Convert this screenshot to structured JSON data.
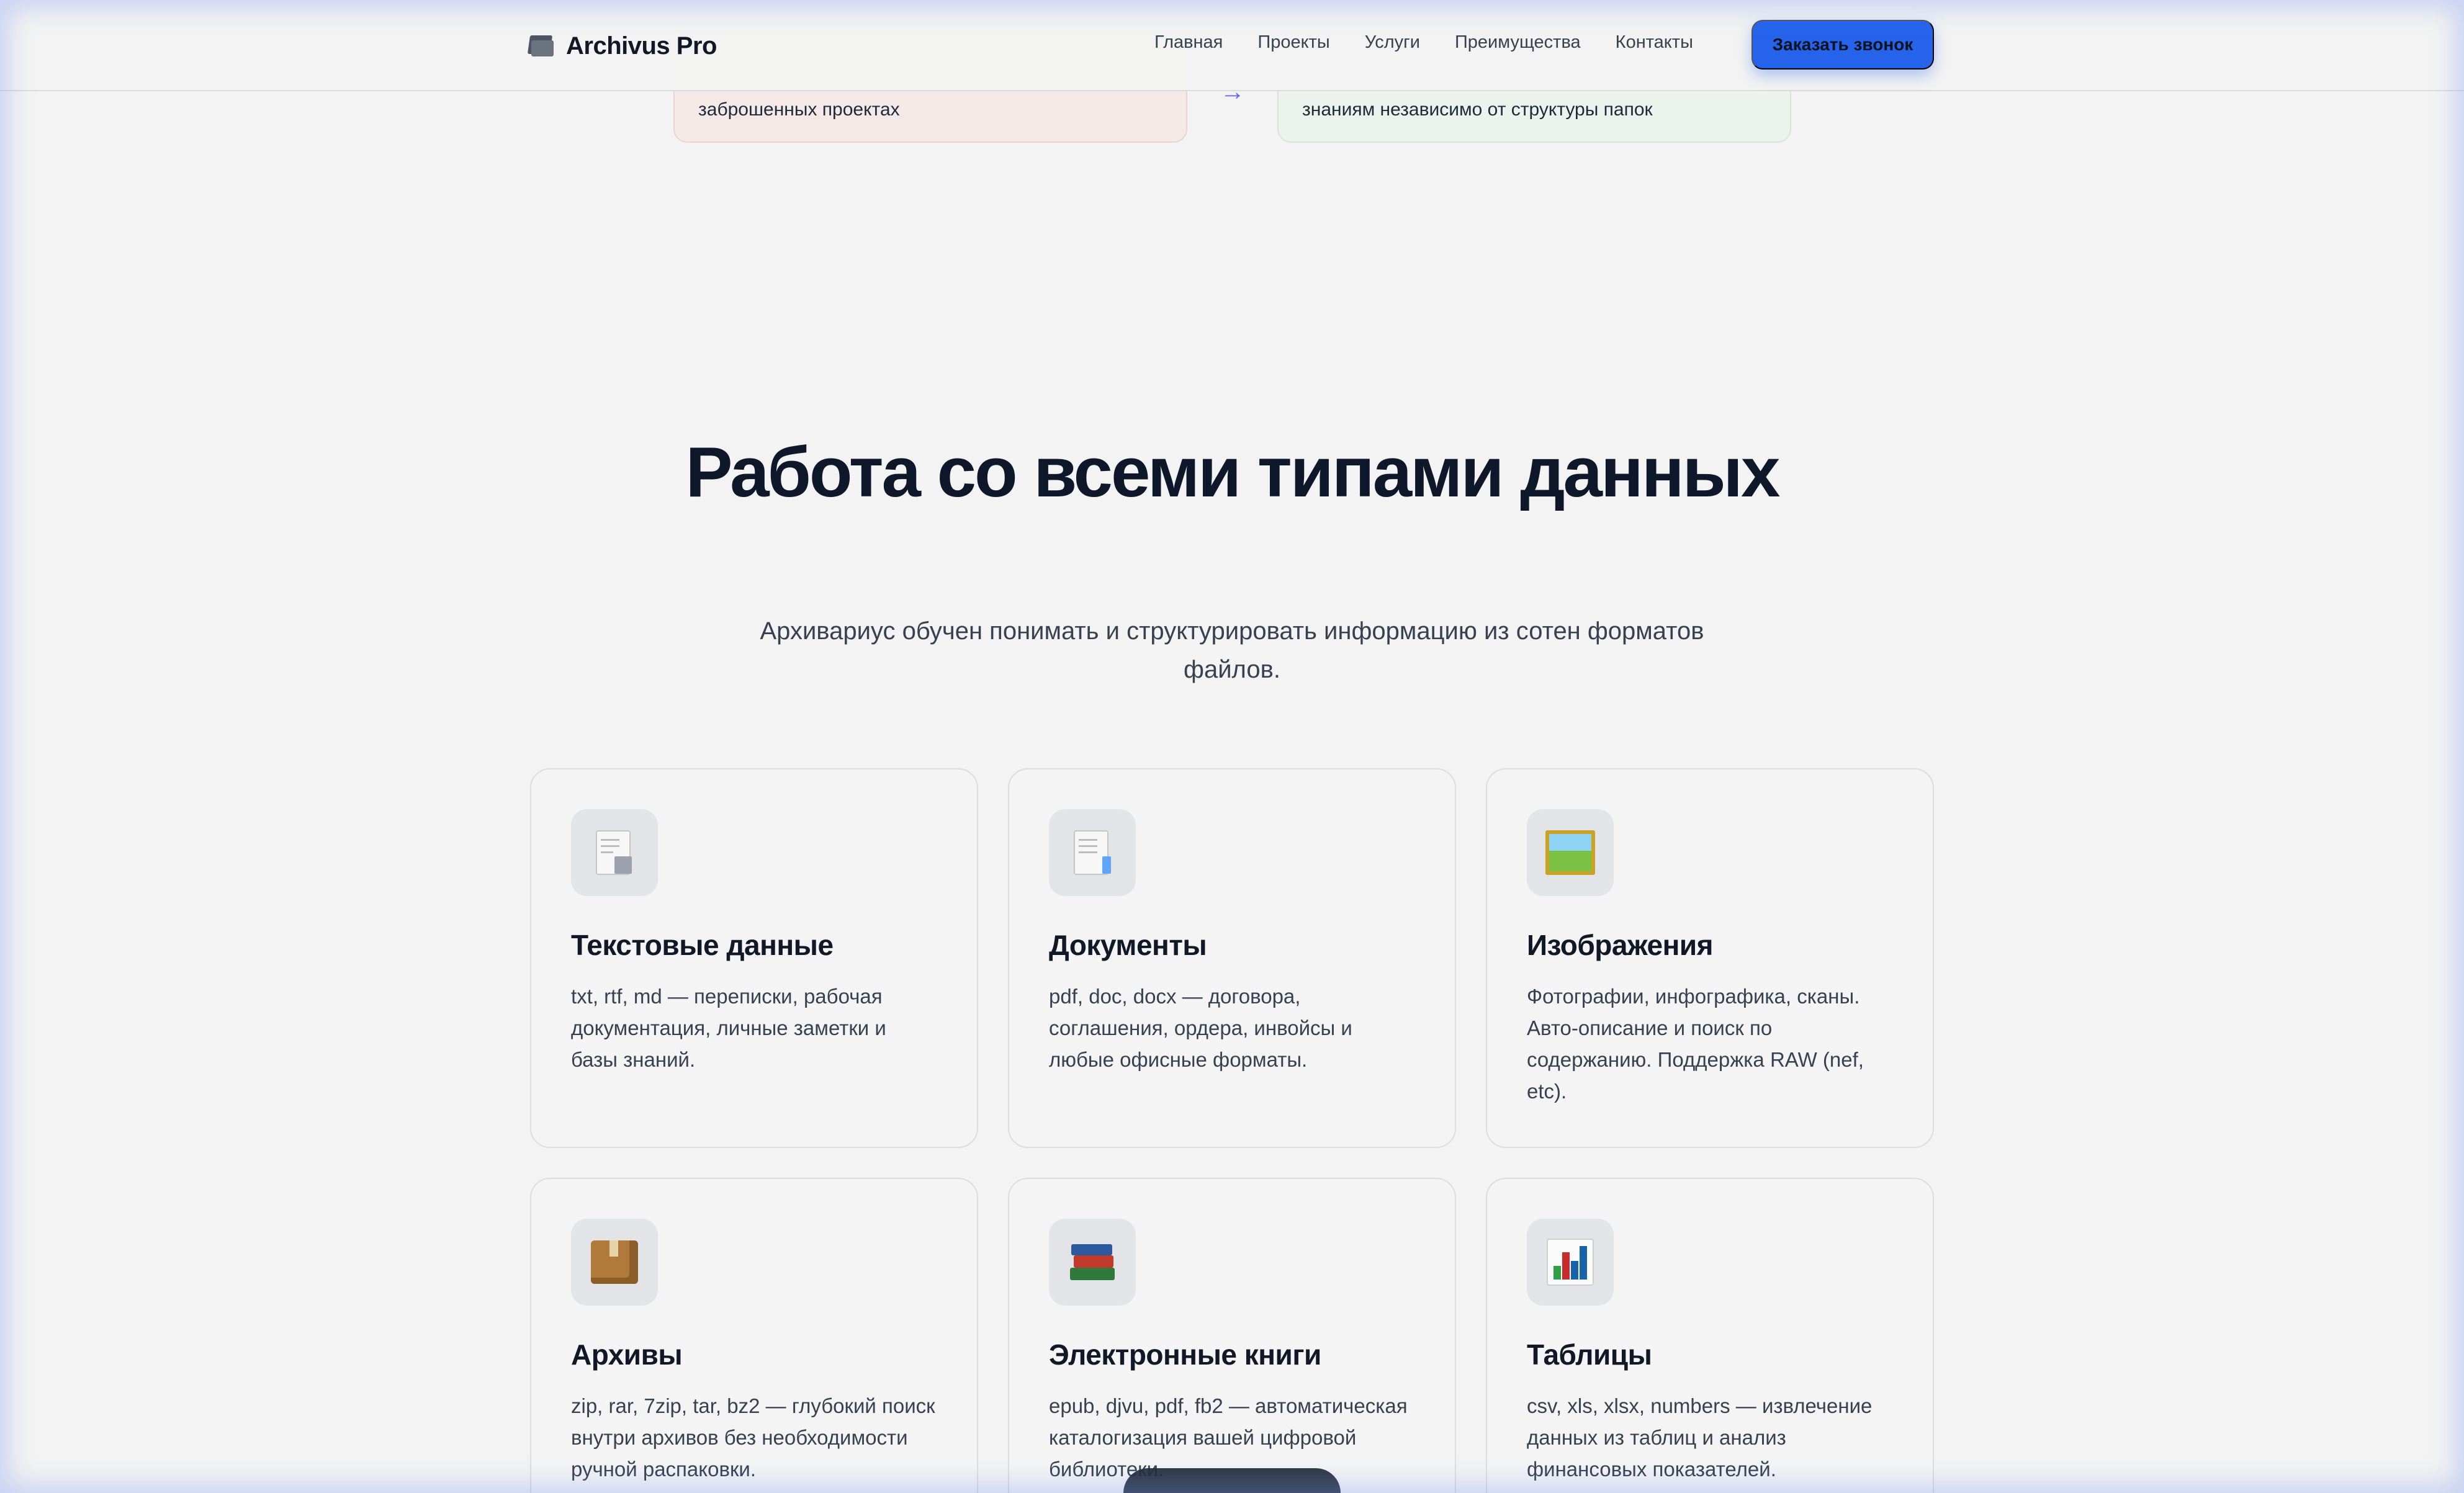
{
  "header": {
    "logo_text": "Archivus Pro",
    "logo_icon": "folder-icon",
    "nav": [
      "Главная",
      "Проекты",
      "Услуги",
      "Преимущества",
      "Контакты"
    ],
    "cta_label": "Заказать звонок",
    "accent_color": "#2563eb"
  },
  "compare": {
    "bad_text": "заброшенных проектах",
    "good_text": "знаниям независимо от структуры папок",
    "arrow": "→"
  },
  "section": {
    "title": "Работа со всеми типами данных",
    "subtitle": "Архивариус обучен понимать и структурировать информацию из сотен форматов файлов."
  },
  "cards": [
    {
      "icon": "text-file-icon",
      "title": "Текстовые данные",
      "desc": "txt, rtf, md — переписки, рабочая документация, личные заметки и базы знаний."
    },
    {
      "icon": "document-icon",
      "title": "Документы",
      "desc": "pdf, doc, docx — договора, соглашения, ордера, инвойсы и любые офисные форматы."
    },
    {
      "icon": "picture-icon",
      "title": "Изображения",
      "desc": "Фотографии, инфографика, сканы. Авто-описание и поиск по содержанию. Поддержка RAW (nef, etc)."
    },
    {
      "icon": "package-icon",
      "title": "Архивы",
      "desc": "zip, rar, 7zip, tar, bz2 — глубокий поиск внутри архивов без необходимости ручной распаковки."
    },
    {
      "icon": "books-icon",
      "title": "Электронные книги",
      "desc": "epub, djvu, pdf, fb2 — автоматическая каталогизация вашей цифровой библиотеки."
    },
    {
      "icon": "bar-chart-icon",
      "title": "Таблицы",
      "desc": "csv, xls, xlsx, numbers — извлечение данных из таблиц и анализ финансовых показателей."
    }
  ]
}
